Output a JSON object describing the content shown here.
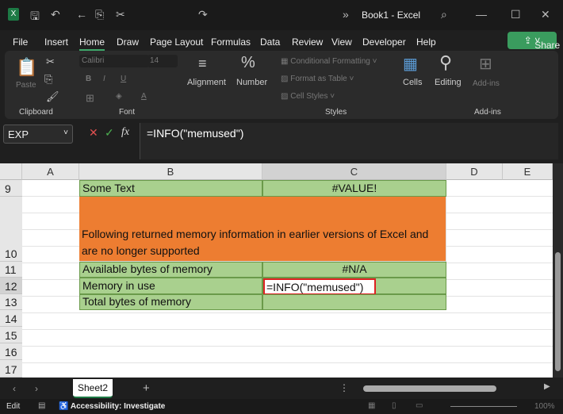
{
  "title": {
    "doc": "Book1",
    "sep": "-",
    "app": "Excel",
    "overflow": "»"
  },
  "menu": [
    "File",
    "Insert",
    "Home",
    "Draw",
    "Page Layout",
    "Formulas",
    "Data",
    "Review",
    "View",
    "Developer",
    "Help"
  ],
  "share": "Share",
  "ribbon": {
    "paste": "Paste",
    "clipboard": "Clipboard",
    "font_name": "Calibri",
    "font_size": "14",
    "font": "Font",
    "bold": "B",
    "italic": "I",
    "underline": "U",
    "alignment": "Alignment",
    "number": "Number",
    "number_glyph": "%",
    "cond": "Conditional Formatting",
    "fat": "Format as Table",
    "cellstyles": "Cell Styles",
    "styles": "Styles",
    "cells": "Cells",
    "editing": "Editing",
    "addins": "Add-ins",
    "addins_group": "Add-ins"
  },
  "formula": {
    "namebox": "EXP",
    "fx": "fx",
    "value": "=INFO(\"memused\")"
  },
  "columns": [
    "A",
    "B",
    "C",
    "D",
    "E"
  ],
  "rows": [
    "9",
    "10",
    "11",
    "12",
    "13",
    "14",
    "15",
    "16",
    "17"
  ],
  "cells": {
    "b9": "Some Text",
    "c9": "#VALUE!",
    "b10": "Following returned memory information in earlier versions of Excel and are no longer supported",
    "b11": "Available bytes of memory",
    "c11": "#N/A",
    "b12": "Memory in use",
    "c12": "=INFO(\"memused\")",
    "b13": "Total bytes of memory"
  },
  "sheet": {
    "tab": "Sheet2",
    "add": "+"
  },
  "status": {
    "mode": "Edit",
    "accessibility": "Accessibility: Investigate",
    "zoom": "100%"
  }
}
